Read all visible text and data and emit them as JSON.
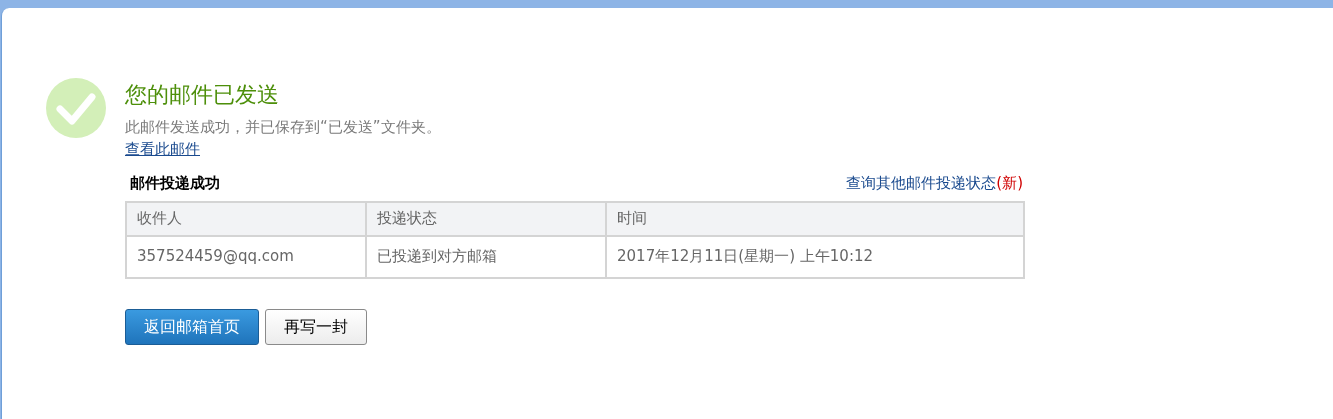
{
  "result": {
    "title": "您的邮件已发送",
    "message": "此邮件发送成功，并已保存到“已发送”文件夹。",
    "view_link": "查看此邮件"
  },
  "delivery": {
    "title": "邮件投递成功",
    "status_link": "查询其他邮件投递状态",
    "new_mark": "(新)",
    "table": {
      "columns": [
        "收件人",
        "投递状态",
        "时间"
      ],
      "rows": [
        [
          "357524459@qq.com",
          "已投递到对方邮箱",
          "2017年12月11日(星期一) 上午10:12"
        ]
      ]
    }
  },
  "buttons": [
    {
      "label": "返回邮箱首页",
      "kind": "primary"
    },
    {
      "label": "再写一封",
      "kind": "secondary"
    }
  ]
}
